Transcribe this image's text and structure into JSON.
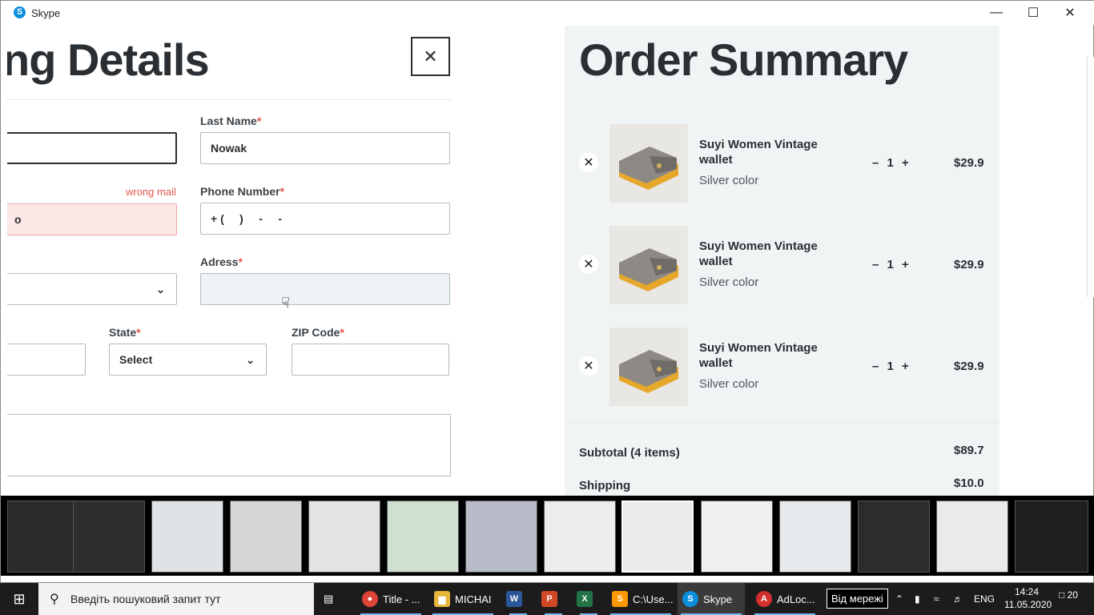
{
  "window": {
    "title": "Skype",
    "minimize": "—",
    "maximize": "☐",
    "close": "✕"
  },
  "form": {
    "heading": "ng Details",
    "close_label": "✕",
    "last_name_label": "Last Name",
    "last_name_value": "Nowak",
    "error_text": "wrong mail",
    "email_value_fragment": "o",
    "phone_label": "Phone Number",
    "phone_value": "+ (     )     -     -",
    "address_label": "Adress",
    "state_label": "State",
    "state_value": "Select",
    "zip_label": "ZIP Code",
    "required_mark": "*"
  },
  "summary": {
    "heading": "Order Summary",
    "items": [
      {
        "name": "Suyi Women Vintage wallet",
        "color": "Silver color",
        "qty": "– 1 +",
        "price": "$29.9",
        "remove": "✕"
      },
      {
        "name": "Suyi Women Vintage wallet",
        "color": "Silver color",
        "qty": "– 1 +",
        "price": "$29.9",
        "remove": "✕"
      },
      {
        "name": "Suyi Women Vintage wallet",
        "color": "Silver color",
        "qty": "– 1 +",
        "price": "$29.9",
        "remove": "✕"
      }
    ],
    "subtotal_label": "Subtotal (4 items)",
    "subtotal_value": "$89.7",
    "shipping_label": "Shipping",
    "shipping_value": "$10.0"
  },
  "taskbar": {
    "start_icon": "windows-logo",
    "search_placeholder": "Введіть пошуковий запит тут",
    "apps": [
      {
        "label": "Title - ...",
        "icon": "chrome",
        "color": "#db4437",
        "glyph": "●"
      },
      {
        "label": "MICHAI",
        "icon": "folder",
        "color": "#e8b73a",
        "glyph": "▆"
      },
      {
        "label": "",
        "icon": "word",
        "color": "#2b579a",
        "glyph": "W"
      },
      {
        "label": "",
        "icon": "powerpoint",
        "color": "#d24726",
        "glyph": "P"
      },
      {
        "label": "",
        "icon": "excel",
        "color": "#217346",
        "glyph": "X"
      },
      {
        "label": "C:\\Use...",
        "icon": "sublime",
        "color": "#ff9800",
        "glyph": "S"
      },
      {
        "label": "Skype",
        "icon": "skype",
        "color": "#0a8fdc",
        "glyph": "S"
      },
      {
        "label": "AdLoc...",
        "icon": "adlock",
        "color": "#d32f2f",
        "glyph": "A"
      }
    ],
    "network_status": "Від мережі",
    "language": "ENG",
    "time": "14:24",
    "date": "11.05.2020",
    "notifications": "20"
  }
}
